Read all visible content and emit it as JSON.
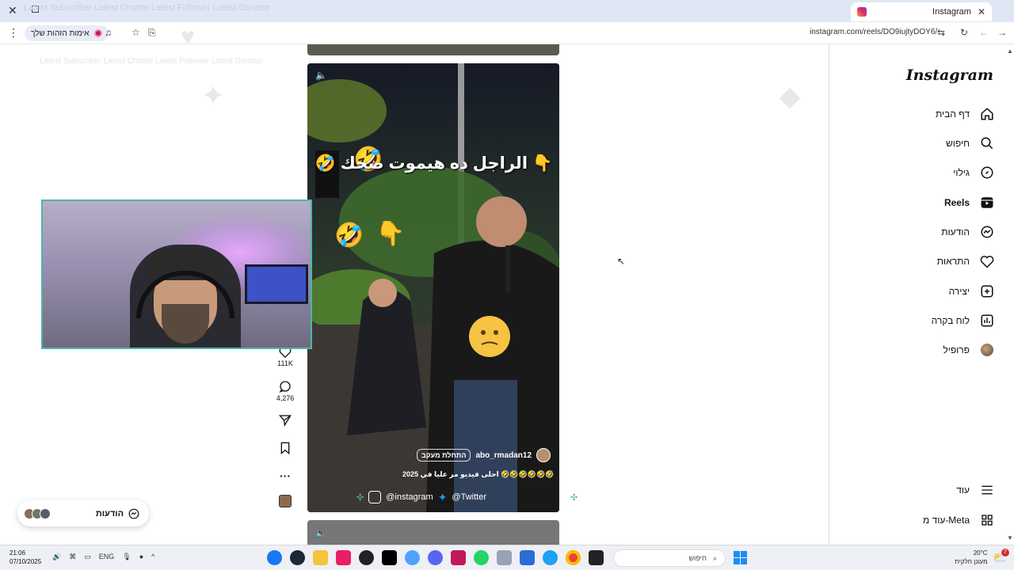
{
  "browser": {
    "tab_title": "Instagram",
    "url": "instagram.com/reels/DO9iujtyDOY6/",
    "profile_pill_label": "אימות הזהות שלך",
    "ghost_tab_text": "Latest Subscriber  Latest Chatter  Latest Follower  Latest Donator"
  },
  "sidebar": {
    "logo": "Instagram",
    "items": [
      {
        "label": "דף הבית",
        "icon": "home-icon"
      },
      {
        "label": "חיפוש",
        "icon": "search-icon"
      },
      {
        "label": "גילוי",
        "icon": "compass-icon"
      },
      {
        "label": "Reels",
        "icon": "reels-icon"
      },
      {
        "label": "הודעות",
        "icon": "messenger-icon"
      },
      {
        "label": "התראות",
        "icon": "heart-icon"
      },
      {
        "label": "יצירה",
        "icon": "plus-square-icon"
      },
      {
        "label": "לוח בקרה",
        "icon": "dashboard-icon"
      },
      {
        "label": "פרופיל",
        "icon": "profile-avatar"
      },
      {
        "label": "עוד",
        "icon": "hamburger-icon"
      },
      {
        "label": "עוד מ-Meta",
        "icon": "grid-icon"
      }
    ]
  },
  "reel": {
    "caption_overlay": "👇 الراجل ده هيموت ضحك 🤣",
    "username": "abo_rmadan12",
    "follow_label": "התחלת מעקב",
    "description": "احلى فيديو مر عليا في 2025 🤣🤣🤣🤣🤣🤣",
    "likes": "111K",
    "comments": "4,276",
    "overlay_ig": "@instagram",
    "overlay_twitter": "@Twitter"
  },
  "messages_box": {
    "label": "הודעות"
  },
  "taskbar": {
    "time": "21:06",
    "date": "07/10/2025",
    "lang": "ENG",
    "search_label": "חיפוש",
    "weather_temp": "20°C",
    "weather_desc": "מעונן חלקית",
    "notif_count": "7"
  },
  "colors": {
    "accent_teal": "#4ab7a9",
    "tab_strip": "#dfe7f5",
    "win_blue": "#1d8cf5"
  }
}
